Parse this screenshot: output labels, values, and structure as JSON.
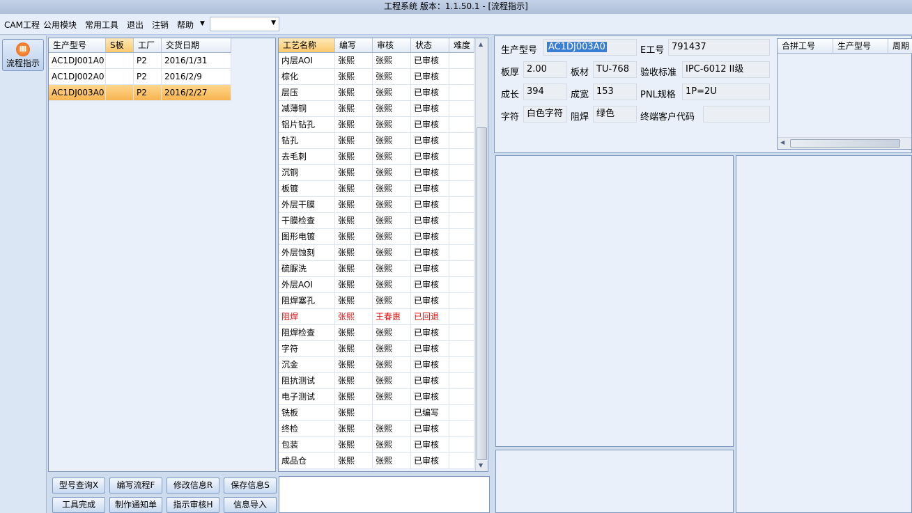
{
  "window": {
    "title": "工程系统   版本：1.1.50.1 - [流程指示]"
  },
  "menu": {
    "items": [
      "CAM工程",
      "公用模块",
      "常用工具",
      "退出",
      "注销",
      "帮助"
    ],
    "dropdown_value": ""
  },
  "nav": {
    "flow_label": "流程指示"
  },
  "models": {
    "headers": [
      "生产型号",
      "S板",
      "工厂",
      "交货日期"
    ],
    "rows": [
      [
        "AC1DJ001A0",
        "",
        "P2",
        "2016/1/31"
      ],
      [
        "AC1DJ002A0",
        "",
        "P2",
        "2016/2/9"
      ],
      [
        "AC1DJ003A0",
        "",
        "P2",
        "2016/2/27"
      ]
    ],
    "selected_row": 2
  },
  "process": {
    "headers": [
      "工艺名称",
      "编写",
      "审核",
      "状态",
      "难度"
    ],
    "rows": [
      [
        "内层AOI",
        "张熙",
        "张熙",
        "已审核",
        ""
      ],
      [
        "棕化",
        "张熙",
        "张熙",
        "已审核",
        ""
      ],
      [
        "层压",
        "张熙",
        "张熙",
        "已审核",
        ""
      ],
      [
        "减薄铜",
        "张熙",
        "张熙",
        "已审核",
        ""
      ],
      [
        "铝片钻孔",
        "张熙",
        "张熙",
        "已审核",
        ""
      ],
      [
        "钻孔",
        "张熙",
        "张熙",
        "已审核",
        ""
      ],
      [
        "去毛刺",
        "张熙",
        "张熙",
        "已审核",
        ""
      ],
      [
        "沉铜",
        "张熙",
        "张熙",
        "已审核",
        ""
      ],
      [
        "板镀",
        "张熙",
        "张熙",
        "已审核",
        ""
      ],
      [
        "外层干膜",
        "张熙",
        "张熙",
        "已审核",
        ""
      ],
      [
        "干膜检查",
        "张熙",
        "张熙",
        "已审核",
        ""
      ],
      [
        "图形电镀",
        "张熙",
        "张熙",
        "已审核",
        ""
      ],
      [
        "外层蚀刻",
        "张熙",
        "张熙",
        "已审核",
        ""
      ],
      [
        "硫脲洗",
        "张熙",
        "张熙",
        "已审核",
        ""
      ],
      [
        "外层AOI",
        "张熙",
        "张熙",
        "已审核",
        ""
      ],
      [
        "阻焊塞孔",
        "张熙",
        "张熙",
        "已审核",
        ""
      ],
      [
        "阻焊",
        "张熙",
        "王春惠",
        "已回退",
        ""
      ],
      [
        "阻焊检查",
        "张熙",
        "张熙",
        "已审核",
        ""
      ],
      [
        "字符",
        "张熙",
        "张熙",
        "已审核",
        ""
      ],
      [
        "沉金",
        "张熙",
        "张熙",
        "已审核",
        ""
      ],
      [
        "阻抗测试",
        "张熙",
        "张熙",
        "已审核",
        ""
      ],
      [
        "电子测试",
        "张熙",
        "张熙",
        "已审核",
        ""
      ],
      [
        "铣板",
        "张熙",
        "",
        "已编写",
        ""
      ],
      [
        "终检",
        "张熙",
        "张熙",
        "已审核",
        ""
      ],
      [
        "包装",
        "张熙",
        "张熙",
        "已审核",
        ""
      ],
      [
        "成品仓",
        "张熙",
        "张熙",
        "已审核",
        ""
      ]
    ],
    "highlight_row": 16,
    "highlight_color": "#d9110f"
  },
  "info": {
    "model_label": "生产型号",
    "model_value": "AC1DJ003A0",
    "e_label": "E工号",
    "e_value": "791437",
    "thick_label": "板厚",
    "thick_value": "2.00",
    "material_label": "板材",
    "material_value": "TU-768",
    "standard_label": "验收标准",
    "standard_value": "IPC-6012 II级",
    "length_label": "成长",
    "length_value": "394",
    "width_label": "成宽",
    "width_value": "153",
    "pnl_label": "PNL规格",
    "pnl_value": "1P=2U",
    "char_label": "字符",
    "char_value": "白色字符",
    "mask_label": "阻焊",
    "mask_value": "绿色",
    "customer_label": "终端客户代码",
    "customer_value": ""
  },
  "merge": {
    "headers": [
      "合拼工号",
      "生产型号",
      "周期"
    ]
  },
  "buttons": {
    "row1": [
      "型号查询X",
      "编写流程F",
      "修改信息R",
      "保存信息S"
    ],
    "row2": [
      "工具完成",
      "制作通知单",
      "指示审核H",
      "信息导入"
    ]
  },
  "colors": {
    "selection": "#f8b44f",
    "accent": "#3b7fd5"
  }
}
